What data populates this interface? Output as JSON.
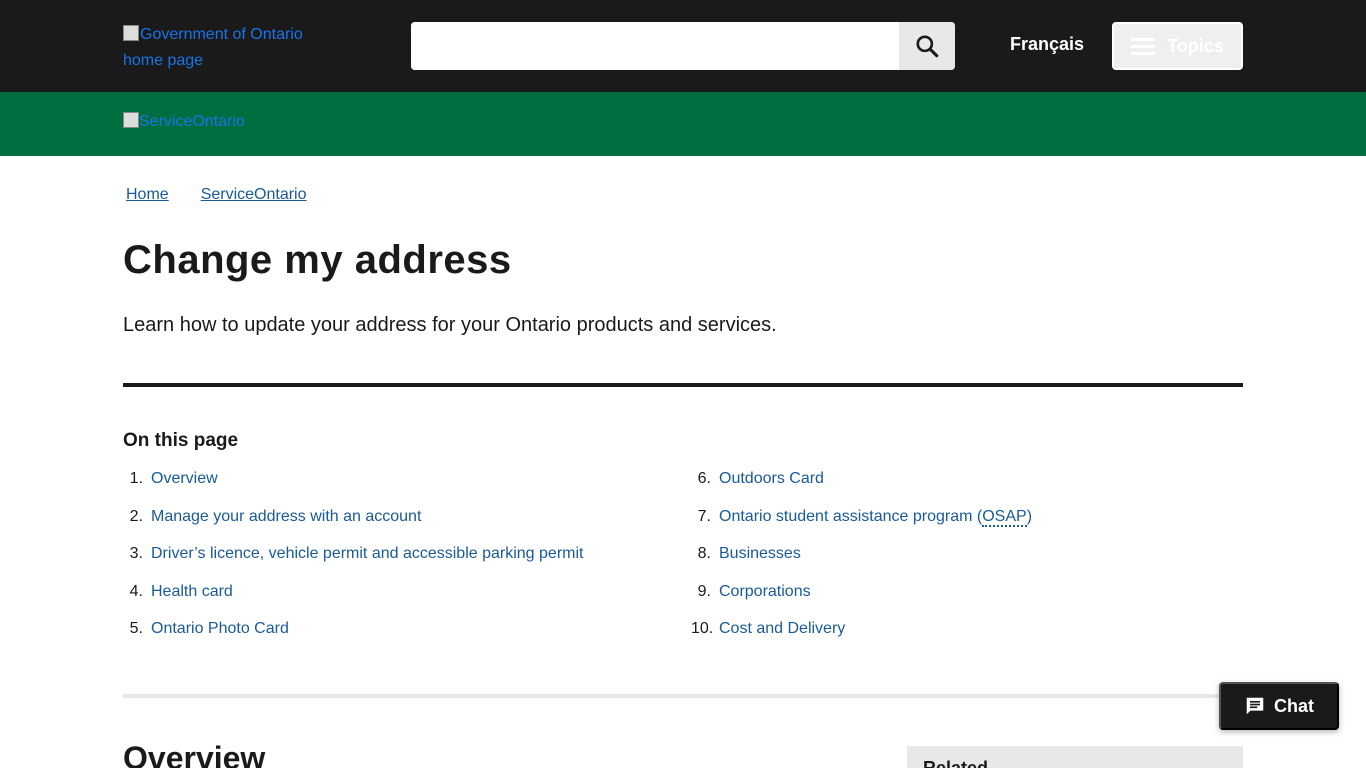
{
  "header": {
    "gov_logo_alt": "Government of Ontario home page",
    "search": {
      "placeholder": "",
      "value": ""
    },
    "search_icon": "search-icon",
    "language_label": "Français",
    "topics_label": "Topics",
    "topics_icon": "menu-icon"
  },
  "subheader": {
    "logo_alt": "ServiceOntario"
  },
  "breadcrumb": [
    {
      "label": "Home"
    },
    {
      "label": "ServiceOntario"
    }
  ],
  "page": {
    "title": "Change my address",
    "lead": "Learn how to update your address for your Ontario products and services."
  },
  "toc": {
    "heading": "On this page",
    "items": [
      {
        "num": "1.",
        "label": "Overview"
      },
      {
        "num": "2.",
        "label": "Manage your address with an account"
      },
      {
        "num": "3.",
        "label": "Driver’s licence, vehicle permit and accessible parking permit"
      },
      {
        "num": "4.",
        "label": "Health card"
      },
      {
        "num": "5.",
        "label": "Ontario Photo Card"
      },
      {
        "num": "6.",
        "label": "Outdoors Card"
      },
      {
        "num": "7.",
        "label": "Ontario student assistance program (",
        "abbr": "OSAP",
        "suffix": ")"
      },
      {
        "num": "8.",
        "label": "Businesses"
      },
      {
        "num": "9.",
        "label": "Corporations"
      },
      {
        "num": "10.",
        "label": "Cost and Delivery"
      }
    ]
  },
  "overview": {
    "heading": "Overview"
  },
  "related": {
    "heading": "Related"
  },
  "chat": {
    "label": "Chat",
    "icon": "chat-icon"
  },
  "colors": {
    "topbar": "#1a1a1a",
    "greenbar": "#006e3f",
    "link": "#1a5a96"
  }
}
